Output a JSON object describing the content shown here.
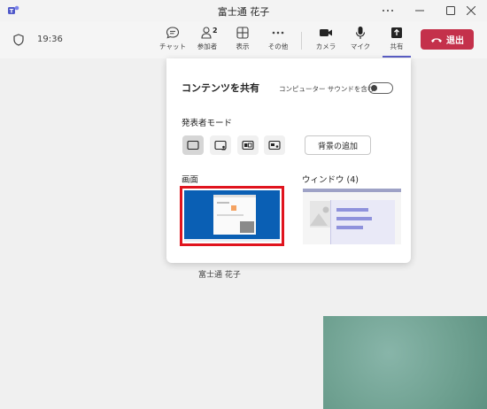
{
  "window": {
    "title": "富士通 花子"
  },
  "meeting": {
    "time": "19:36",
    "participant_name": "富士通 花子"
  },
  "toolbar": {
    "chat": "チャット",
    "participants": "参加者",
    "participants_count": "2",
    "view": "表示",
    "more": "その他",
    "camera": "カメラ",
    "mic": "マイク",
    "share": "共有",
    "leave": "退出"
  },
  "share_panel": {
    "title": "コンテンツを共有",
    "include_sound_label": "コンピューター サウンドを含む",
    "include_sound": false,
    "presenter_mode_label": "発表者モード",
    "add_background_label": "背景の追加",
    "screen_label": "画面",
    "window_label": "ウィンドウ (4)"
  },
  "colors": {
    "accent": "#5b5fc7",
    "leave": "#c4314b",
    "highlight": "#e0141e"
  },
  "icons": [
    "shield-icon",
    "chat-icon",
    "people-icon",
    "view-icon",
    "more-icon",
    "camera-icon",
    "mic-icon",
    "share-icon",
    "phone-hangup-icon"
  ]
}
